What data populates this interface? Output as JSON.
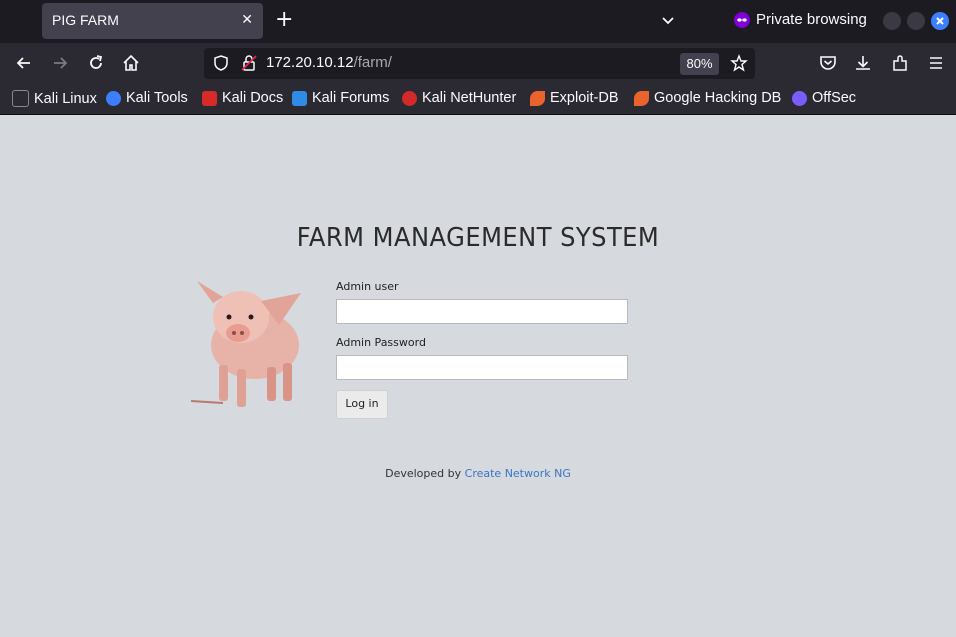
{
  "browser": {
    "tab_title": "PIG FARM",
    "private_label": "Private browsing",
    "url_host": "172.20.10.12",
    "url_path": "/farm/",
    "zoom": "80%",
    "bookmarks": [
      {
        "label": "Kali Linux",
        "color": "#ffffff"
      },
      {
        "label": "Kali Tools",
        "color": "#3d7eff"
      },
      {
        "label": "Kali Docs",
        "color": "#d92a2a"
      },
      {
        "label": "Kali Forums",
        "color": "#2f8be6"
      },
      {
        "label": "Kali NetHunter",
        "color": "#d22a2a"
      },
      {
        "label": "Exploit-DB",
        "color": "#e8642c"
      },
      {
        "label": "Google Hacking DB",
        "color": "#e8642c"
      },
      {
        "label": "OffSec",
        "color": "#7b5cff"
      }
    ]
  },
  "page": {
    "title": "FARM MANAGEMENT SYSTEM",
    "user_label": "Admin user",
    "user_value": "",
    "password_label": "Admin Password",
    "password_value": "",
    "login_label": "Log in",
    "footer_prefix": "Developed by ",
    "footer_link": "Create Network NG"
  },
  "colors": {
    "page_bg": "#d6d9de",
    "link": "#3a75c4",
    "chrome_dark": "#1c1b22",
    "chrome": "#2b2a33"
  }
}
